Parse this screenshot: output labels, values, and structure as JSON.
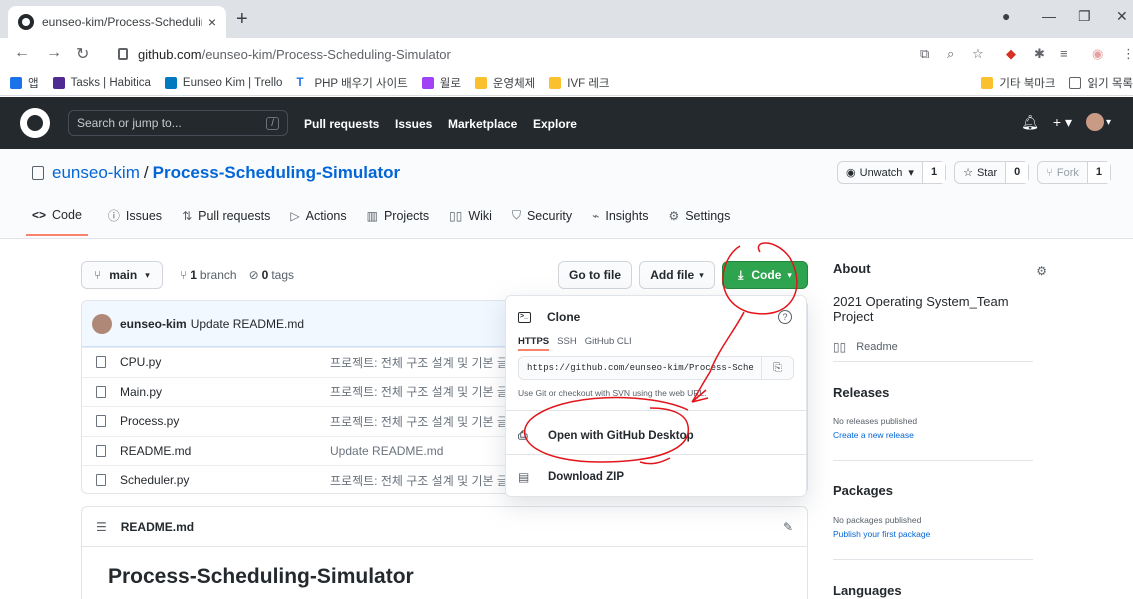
{
  "browser": {
    "tab_title": "eunseo-kim/Process-Scheduling",
    "tab_close": "×",
    "new_tab": "+",
    "url_host": "github.com",
    "url_path": "/eunseo-kim/Process-Scheduling-Simulator",
    "bookmarks": [
      {
        "label": "앱",
        "color": "#fbbc04"
      },
      {
        "label": "Tasks | Habitica",
        "color": "#4f2a93"
      },
      {
        "label": "Eunseo Kim | Trello",
        "color": "#0079bf"
      },
      {
        "label": "PHP 배우기 사이트",
        "color": "#1a73e8"
      },
      {
        "label": "윌로",
        "color": "#a142f4"
      },
      {
        "label": "운영체제",
        "color": "#fbc02d"
      },
      {
        "label": "IVF 레크",
        "color": "#fbc02d"
      }
    ],
    "bookmarks_right": [
      "기타 북마크",
      "읽기 목록"
    ]
  },
  "github_header": {
    "search_placeholder": "Search or jump to...",
    "search_hotkey": "/",
    "nav": [
      "Pull requests",
      "Issues",
      "Marketplace",
      "Explore"
    ]
  },
  "repo": {
    "owner": "eunseo-kim",
    "name": "Process-Scheduling-Simulator",
    "watch_label": "Unwatch",
    "watch_count": "1",
    "star_label": "Star",
    "star_count": "0",
    "fork_label": "Fork",
    "fork_count": "1",
    "tabs": [
      {
        "label": "Code",
        "icon": "<>"
      },
      {
        "label": "Issues",
        "icon": "ⓘ"
      },
      {
        "label": "Pull requests",
        "icon": "⇅"
      },
      {
        "label": "Actions",
        "icon": "▷"
      },
      {
        "label": "Projects",
        "icon": "▥"
      },
      {
        "label": "Wiki",
        "icon": "📖"
      },
      {
        "label": "Security",
        "icon": "⛉"
      },
      {
        "label": "Insights",
        "icon": "⌁"
      },
      {
        "label": "Settings",
        "icon": "⚙"
      }
    ]
  },
  "branch_bar": {
    "branch": "main",
    "branch_count": "1",
    "branch_word": "branch",
    "tag_count": "0",
    "tag_word": "tags",
    "go_to_file": "Go to file",
    "add_file": "Add file",
    "code": "Code"
  },
  "latest_commit": {
    "author": "eunseo-kim",
    "message": "Update README.md"
  },
  "files": [
    {
      "name": "CPU.py",
      "message": "프로젝트: 전체 구조 설계 및 기본 글"
    },
    {
      "name": "Main.py",
      "message": "프로젝트: 전체 구조 설계 및 기본 글"
    },
    {
      "name": "Process.py",
      "message": "프로젝트: 전체 구조 설계 및 기본 글"
    },
    {
      "name": "README.md",
      "message": "Update README.md"
    },
    {
      "name": "Scheduler.py",
      "message": "프로젝트: 전체 구조 설계 및 기본 글"
    }
  ],
  "readme": {
    "filename": "README.md",
    "heading": "Process-Scheduling-Simulator"
  },
  "clone_dropdown": {
    "title": "Clone",
    "tabs": [
      "HTTPS",
      "SSH",
      "GitHub CLI"
    ],
    "url": "https://github.com/eunseo-kim/Process-Sche",
    "note": "Use Git or checkout with SVN using the web URL.",
    "open_desktop": "Open with GitHub Desktop",
    "download_zip": "Download ZIP"
  },
  "sidebar": {
    "about_title": "About",
    "description": "2021 Operating System_Team Project",
    "readme_link": "Readme",
    "releases_title": "Releases",
    "releases_none": "No releases published",
    "releases_link": "Create a new release",
    "packages_title": "Packages",
    "packages_none": "No packages published",
    "packages_link": "Publish your first package",
    "languages_title": "Languages"
  }
}
